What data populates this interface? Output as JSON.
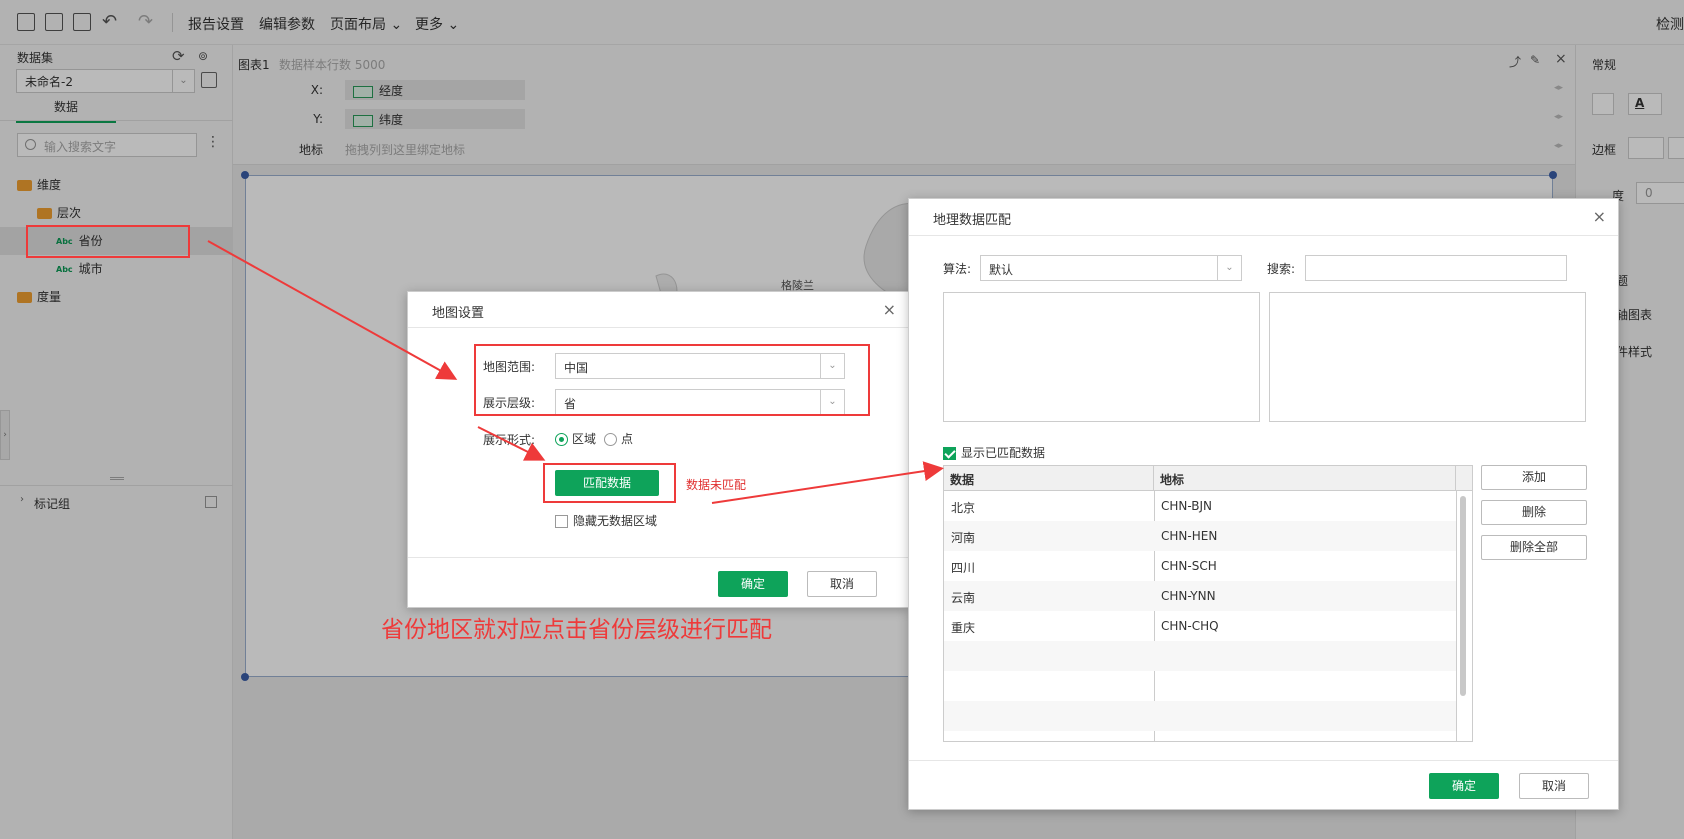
{
  "toolbar": {
    "menus": [
      "报告设置",
      "编辑参数",
      "页面布局 ⌄",
      "更多 ⌄"
    ],
    "right_label": "检测"
  },
  "left_panel": {
    "dataset_label": "数据集",
    "dataset_value": "未命名-2",
    "tab_data": "数据",
    "search_placeholder": "输入搜索文字",
    "tree": [
      {
        "label": "维度",
        "kind": "folder"
      },
      {
        "label": "层次",
        "kind": "folder"
      },
      {
        "label": "省份",
        "kind": "field",
        "badge": "Abc"
      },
      {
        "label": "城市",
        "kind": "field",
        "badge": "Abc"
      },
      {
        "label": "度量",
        "kind": "folder"
      }
    ],
    "marker_group": "标记组"
  },
  "chart": {
    "title": "图表1",
    "sample_rows": "数据样本行数 5000",
    "x_label": "X:",
    "x_value": "经度",
    "y_label": "Y:",
    "y_value": "纬度",
    "geo_label": "地标",
    "geo_hint": "拖拽列到这里绑定地标",
    "map_fragment_label": "格陵兰"
  },
  "right_panel": {
    "section": "常规",
    "border_label": "边框",
    "input_value": "0",
    "opacity_label": "度",
    "label_a": "题",
    "label_b": "轴图表",
    "label_c": "件样式"
  },
  "map_settings_dialog": {
    "title": "地图设置",
    "range_label": "地图范围:",
    "range_value": "中国",
    "level_label": "展示层级:",
    "level_value": "省",
    "form_label": "展示形式:",
    "form_options": [
      "区域",
      "点"
    ],
    "match_button": "匹配数据",
    "unmatched_note": "数据未匹配",
    "hide_nodata": "隐藏无数据区域",
    "ok": "确定",
    "cancel": "取消"
  },
  "geo_match_dialog": {
    "title": "地理数据匹配",
    "algo_label": "算法:",
    "algo_value": "默认",
    "search_label": "搜索:",
    "show_matched": "显示已匹配数据",
    "col_data": "数据",
    "col_geo": "地标",
    "rows": [
      {
        "data": "北京",
        "geo": "CHN-BJN"
      },
      {
        "data": "河南",
        "geo": "CHN-HEN"
      },
      {
        "data": "四川",
        "geo": "CHN-SCH"
      },
      {
        "data": "云南",
        "geo": "CHN-YNN"
      },
      {
        "data": "重庆",
        "geo": "CHN-CHQ"
      }
    ],
    "add": "添加",
    "delete": "删除",
    "delete_all": "删除全部",
    "ok": "确定",
    "cancel": "取消"
  },
  "annotation": {
    "caption": "省份地区就对应点击省份层级进行匹配",
    "color": "#ee3a3a"
  }
}
